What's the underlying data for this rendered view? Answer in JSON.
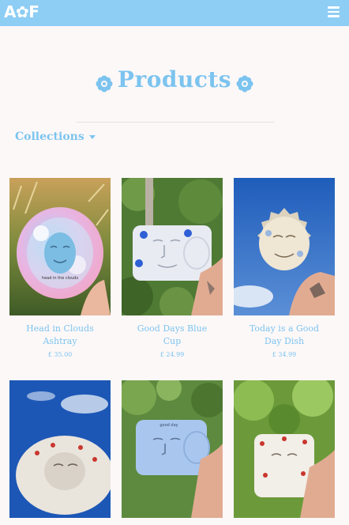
{
  "header": {
    "logo": "A✿F",
    "menu_icon": "hamburger-icon"
  },
  "page": {
    "title": "Products",
    "title_icon": "flower-icon"
  },
  "filter": {
    "label": "Collections"
  },
  "products": [
    {
      "name_line1": "Head in Clouds",
      "name_line2": "Ashtray",
      "price": "£ 35.00",
      "image_text": "head in the clouds"
    },
    {
      "name_line1": "Good Days Blue",
      "name_line2": "Cup",
      "price": "£ 24.99"
    },
    {
      "name_line1": "Today is a Good",
      "name_line2": "Day Dish",
      "price": "£ 34.99"
    },
    {
      "name_line1": "",
      "name_line2": "",
      "price": ""
    },
    {
      "name_line1": "",
      "name_line2": "",
      "price": "",
      "image_text": "good day"
    },
    {
      "name_line1": "",
      "name_line2": "",
      "price": ""
    }
  ],
  "colors": {
    "accent": "#7cc4ef",
    "topbar": "#8ecdf4",
    "background": "#fdf8f8"
  }
}
